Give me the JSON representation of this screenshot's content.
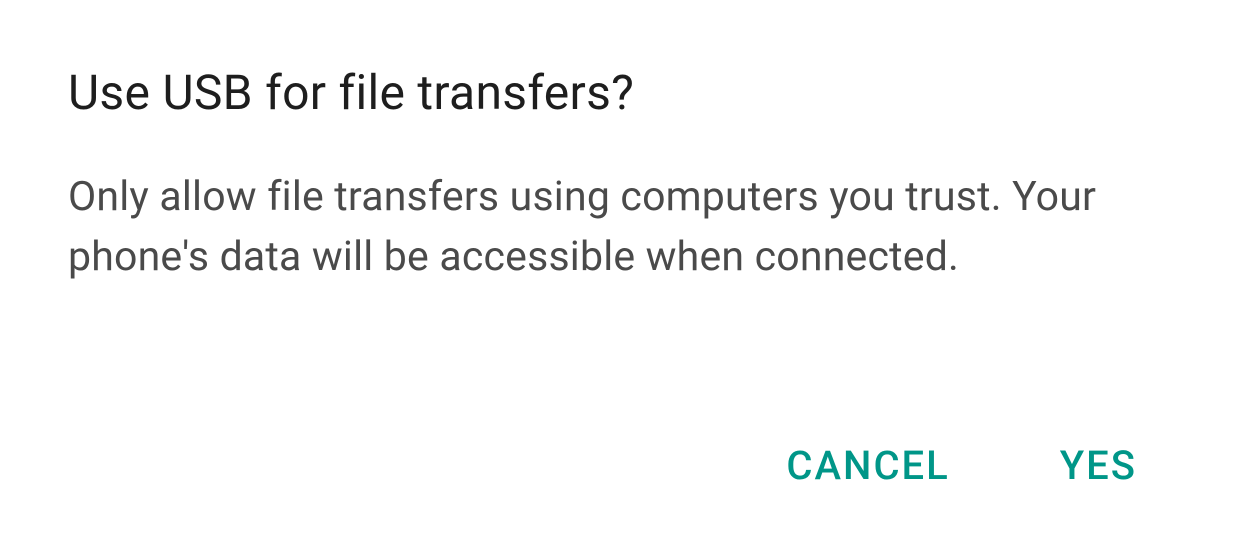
{
  "dialog": {
    "title": "Use USB for file transfers?",
    "message": "Only allow file transfers using computers you trust. Your phone's data will be accessible when connected.",
    "actions": {
      "cancel": "CANCEL",
      "confirm": "YES"
    }
  }
}
